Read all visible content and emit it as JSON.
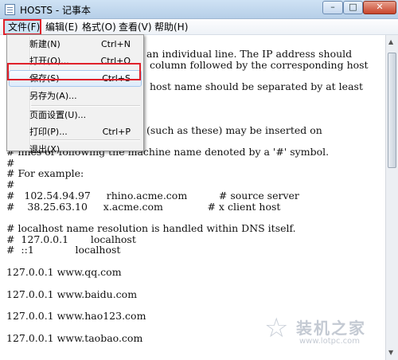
{
  "window": {
    "title": "HOSTS - 记事本",
    "minimize_glyph": "–",
    "maximize_glyph": "□",
    "close_glyph": "✕"
  },
  "menubar": [
    {
      "label": "文件(F)",
      "active": true
    },
    {
      "label": "编辑(E)"
    },
    {
      "label": "格式(O)"
    },
    {
      "label": "查看(V)"
    },
    {
      "label": "帮助(H)"
    }
  ],
  "file_menu": {
    "items": [
      {
        "label": "新建(N)",
        "shortcut": "Ctrl+N"
      },
      {
        "label": "打开(O)...",
        "shortcut": "Ctrl+O"
      },
      {
        "label": "保存(S)",
        "shortcut": "Ctrl+S",
        "highlighted": true
      },
      {
        "label": "另存为(A)...",
        "shortcut": ""
      },
      {
        "label": "页面设置(U)...",
        "shortcut": ""
      },
      {
        "label": "打印(P)...",
        "shortcut": "Ctrl+P"
      },
      {
        "label": "退出(X)",
        "shortcut": ""
      }
    ]
  },
  "editor": {
    "lines": [
      " an individual line. The IP address should",
      "column followed by the corresponding host",
      "",
      "host name should be separated by at least",
      "",
      "",
      " (such as these) may be inserted on",
      "# lines or following the machine name denoted by a '#' symbol.",
      "#",
      "# For example:",
      "#",
      "#   102.54.94.97     rhino.acme.com          # source server",
      "#    38.25.63.10     x.acme.com              # x client host",
      "",
      "# localhost name resolution is handled within DNS itself.",
      "#  127.0.0.1       localhost",
      "#  ::1             localhost",
      "",
      "127.0.0.1 www.qq.com",
      "",
      "127.0.0.1 www.baidu.com",
      "",
      "127.0.0.1 www.hao123.com",
      "",
      "127.0.0.1 www.taobao.com"
    ]
  },
  "scrollbar": {
    "up_glyph": "▲",
    "down_glyph": "▼"
  },
  "watermark": {
    "star_glyph": "☆",
    "logo_text": "装机之家",
    "url": "www.lotpc.com"
  },
  "colors": {
    "highlight_border": "#e0202a",
    "menu_hover": "#dcebfb"
  }
}
